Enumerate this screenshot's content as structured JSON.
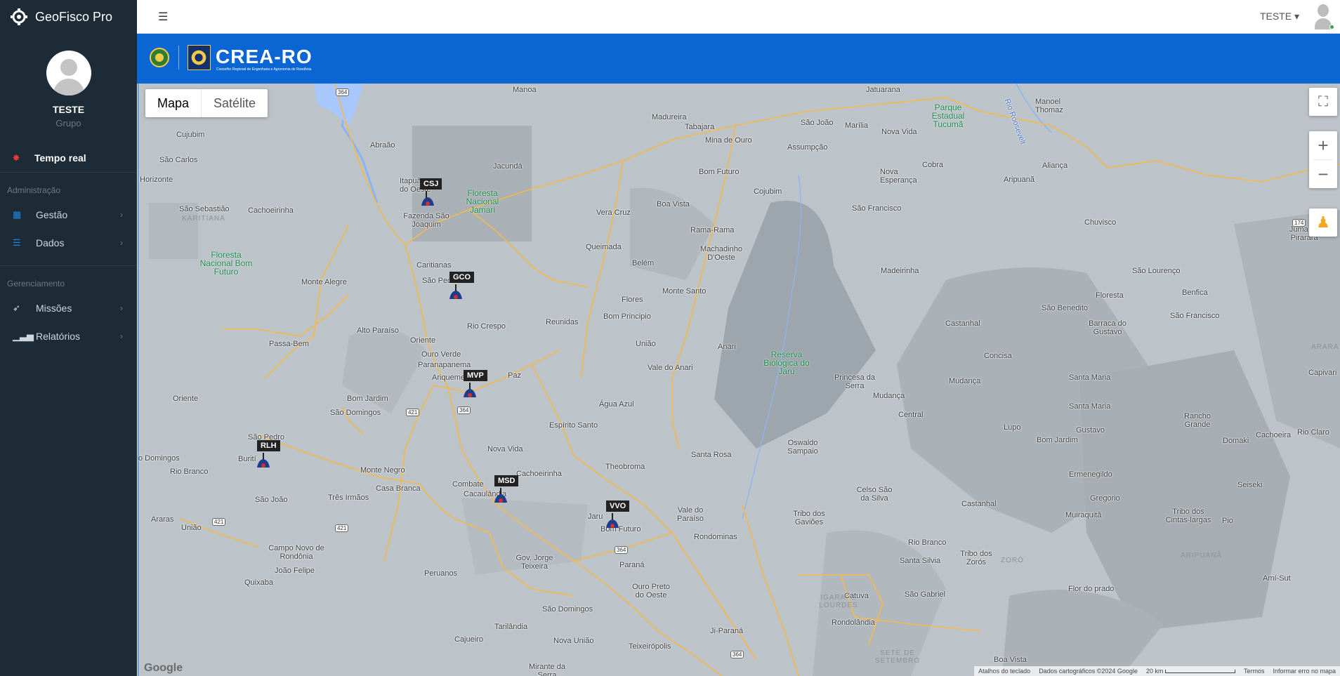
{
  "app": {
    "title": "GeoFisco Pro",
    "user_name": "TESTE",
    "user_group": "Grupo"
  },
  "sidebar": {
    "realtime_label": "Tempo real",
    "sections": [
      {
        "title": "Administração",
        "items": [
          {
            "label": "Gestão",
            "icon": "grid-icon"
          },
          {
            "label": "Dados",
            "icon": "list-icon"
          }
        ]
      },
      {
        "title": "Gerenciamento",
        "items": [
          {
            "label": "Missões",
            "icon": "rocket-icon"
          },
          {
            "label": "Relatórios",
            "icon": "bar-chart-icon"
          }
        ]
      }
    ]
  },
  "header": {
    "user_menu": "TESTE ▾"
  },
  "banner": {
    "org": "CREA-RO",
    "org_sub": "Conselho Regional de Engenharia e Agronomia de Rondônia"
  },
  "map": {
    "map_type_options": [
      "Mapa",
      "Satélite"
    ],
    "selected_type": "Mapa",
    "markers": [
      "CSJ",
      "GCO",
      "MVP",
      "RLH",
      "MSD",
      "VVO"
    ],
    "places": [
      "Manoa",
      "Jatuarana",
      "Madureira",
      "Tabajara",
      "Mina de Ouro",
      "São João",
      "Marília",
      "Nova Vida",
      "Manoel Thomaz",
      "Assumpção",
      "Cujubim",
      "Abraão",
      "Jacundá",
      "Bom Futuro",
      "Cobra",
      "Nova Esperança",
      "Aliança",
      "Aripuanã",
      "São Carlos",
      "Horizonte",
      "Itapuã do Oeste",
      "Vera Cruz",
      "Boa Vista",
      "Cojubim",
      "São Francisco",
      "Chuvisco",
      "São Sebastião",
      "KARITIANA",
      "Cachoeirinha",
      "Fazenda São Joaquim",
      "Queimada",
      "Rama-Rama",
      "Juma ou Pirarara",
      "Machadinho D'Oeste",
      "Belém",
      "Caritianas",
      "São Pedro",
      "Monte Alegre",
      "Madeirinha",
      "São Lourenço",
      "Floresta",
      "Benfica",
      "Monte Santo",
      "Flores",
      "São Benedito",
      "Reunidas",
      "Bom Principio",
      "Castanhal",
      "Barraca do Gustavo",
      "São Francisco",
      "Rio Crespo",
      "Alto Paraíso",
      "Oriente",
      "União",
      "Anari",
      "Passa-Bem",
      "Ouro Verde",
      "Paranapanema",
      "Concisa",
      "Vale do Anari",
      "Ariquemes",
      "Paz",
      "Princesa da Serra",
      "Mudança",
      "Santa Maria",
      "Mudança",
      "Bom Jardim",
      "Oriente",
      "Água Azul",
      "Santa Maria",
      "Central",
      "Lupo",
      "São Domingos",
      "Gustavo",
      "Rancho Grande",
      "Espírito Santo",
      "Bom Jardim",
      "Domaki",
      "Cachoeira",
      "Rio Claro",
      "São Pedro",
      "Oswaldo Sampaio",
      "Nova Vida",
      "Santa Rosa",
      "o Domingos",
      "Burití",
      "Rio Branco",
      "Monte Negro",
      "Theobroma",
      "Cachoeirinha",
      "Celso São da Silva",
      "Ermenegildo",
      "Combate",
      "Casa Branca",
      "Cacaulândia",
      "São João",
      "Três Irmãos",
      "Seiseki",
      "Castanhal",
      "Gregorio",
      "Vale do Paraíso",
      "Araras",
      "União",
      "Jaru",
      "Tribo dos Gaviões",
      "Muiraquitã",
      "Tribo dos Cintas-largas",
      "Pio",
      "Bom Futuro",
      "Rondominas",
      "Campo Novo de Rondônia",
      "Rio Branco",
      "Tribo dos Zorós",
      "ZORÓ",
      "João Felipe",
      "Gov. Jorge Teixeira",
      "Peruanos",
      "Paraná",
      "Santa Silvia",
      "ARIPUANÃ",
      "Quixaba",
      "Ouro Preto do Oeste",
      "IGARAPÉ LOURDES",
      "Catuva",
      "São Gabriel",
      "Flor do prado",
      "Amí-Sut",
      "São Domingos",
      "Rondolândia",
      "Cajueiro",
      "Tarilândia",
      "Nova União",
      "Teixeirópolis",
      "Ji-Paraná",
      "SETE DE SETEMBRO",
      "Boa Vista",
      "Mirante da Serra",
      "Rio Roosevelt",
      "Capivari",
      "ARARA"
    ],
    "parks": [
      "Floresta Nacional Jamari",
      "Floresta Nacional Bom Futuro",
      "Parque Estadual Tucumã",
      "Reserva Biológica do Jaru"
    ],
    "highways": [
      "364",
      "421",
      "174"
    ],
    "footer": {
      "shortcuts": "Atalhos do teclado",
      "copyright": "Dados cartográficos ©2024 Google",
      "scale": "20 km",
      "terms": "Termos",
      "report": "Informar erro no mapa"
    },
    "google": "Google"
  },
  "colors": {
    "sidebar_bg": "#1c2b36",
    "banner_bg": "#0a66d2",
    "map_bg": "#bcc3c9",
    "road": "#f5b94a",
    "accent": "#1e88e5",
    "realtime_dot": "#e53935"
  }
}
